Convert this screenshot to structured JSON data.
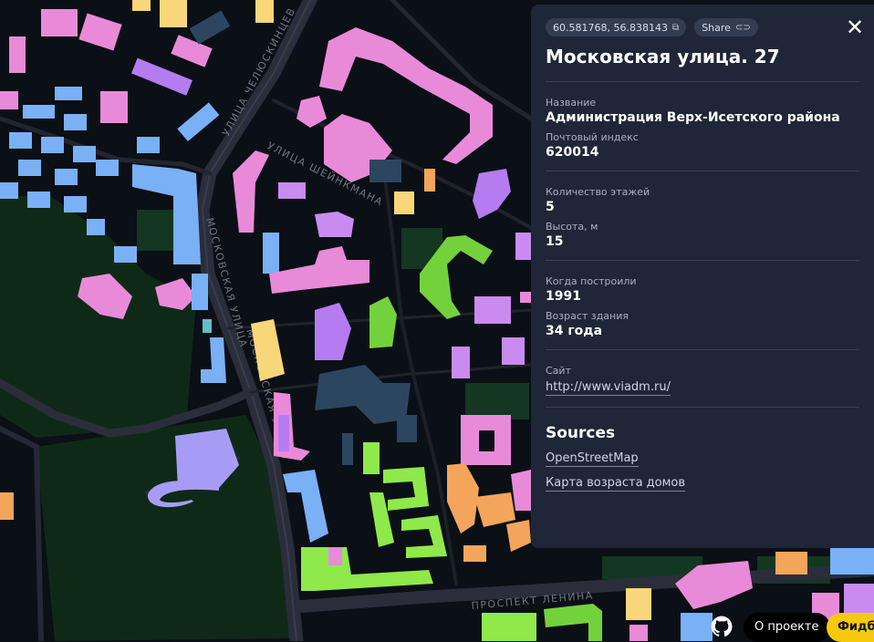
{
  "map": {
    "streets": {
      "chelyuskintsev": "УЛИЦА ЧЕЛЮСКИНЦЕВ",
      "sheinkmana": "УЛИЦА ШЕЙНКМАНА",
      "moskovskaya_left": "МОСКОВСКАЯ УЛИЦА",
      "moskovskaya_right": "МОСКОВСКАЯ УЛИЦА",
      "lenina": "ПРОСПЕКТ ЛЕНИНА"
    },
    "colors": {
      "background": "#0b0f16",
      "park": "#0e2a17",
      "road": "#2b2d3b",
      "pink": "#e98ad9",
      "violet": "#c98bf0",
      "lilac": "#b47cf0",
      "blue": "#7ab0f5",
      "yellow": "#f8d67a",
      "green": "#73d23c",
      "lime": "#8fe94a",
      "orange": "#f3a55b",
      "slate": "#2c4660"
    }
  },
  "panel": {
    "coords": "60.581768, 56.838143",
    "copy_icon": "copy-icon",
    "share_label": "Share",
    "share_icon": "link-icon",
    "close_icon": "close-icon",
    "title": "Московская улица. 27",
    "name_label": "Название",
    "name_value": "Администрация Верх-Исетского района",
    "postcode_label": "Почтовый индекс",
    "postcode_value": "620014",
    "floors_label": "Количество этажей",
    "floors_value": "5",
    "height_label": "Высота, м",
    "height_value": "15",
    "built_label": "Когда построили",
    "built_value": "1991",
    "age_label": "Возраст здания",
    "age_value": "34 года",
    "site_label": "Сайт",
    "site_value": "http://www.viadm.ru/",
    "sources_title": "Sources",
    "sources": [
      "OpenStreetMap",
      "Карта возраста домов"
    ]
  },
  "controls": {
    "github_icon": "github-icon",
    "about_label": "О проекте",
    "feedback_label": "Фидбэк"
  }
}
